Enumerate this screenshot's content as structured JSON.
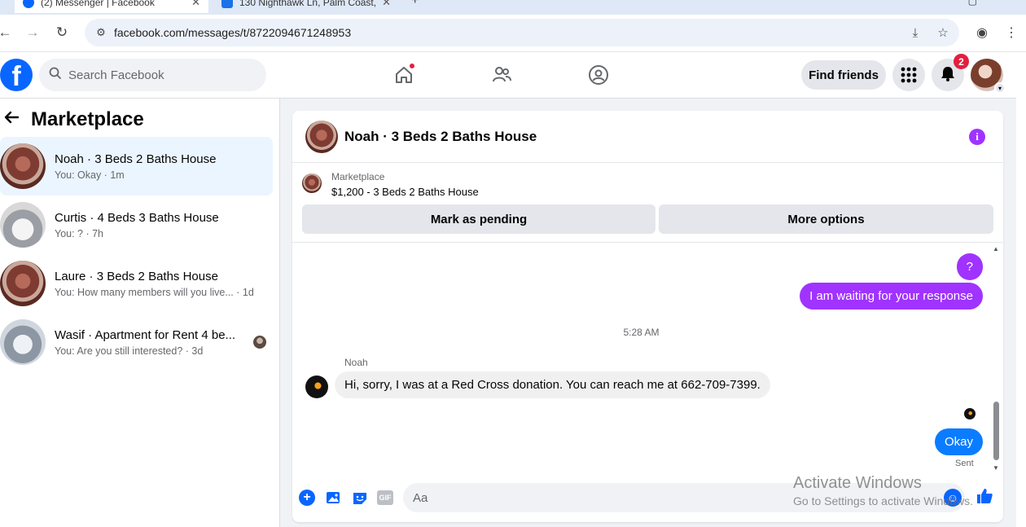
{
  "browser": {
    "tabs": [
      {
        "title": "(2) Messenger | Facebook",
        "active": true
      },
      {
        "title": "130 Nighthawk Ln, Palm Coast,",
        "active": false
      }
    ],
    "url": "facebook.com/messages/t/8722094671248953"
  },
  "fb_header": {
    "logo": "f",
    "search_placeholder": "Search Facebook",
    "find_friends": "Find friends",
    "notifications_count": "2",
    "icons": [
      "home-icon",
      "friends-icon",
      "groups-icon",
      "menu-grid-icon",
      "bell-icon"
    ]
  },
  "sidebar": {
    "title": "Marketplace",
    "conversations": [
      {
        "name": "Noah · 3 Beds 2 Baths House",
        "preview": "You: Okay · 1m",
        "selected": true
      },
      {
        "name": "Curtis · 4 Beds 3 Baths House",
        "preview": "You: ? · 7h",
        "selected": false
      },
      {
        "name": "Laure · 3 Beds 2 Baths House",
        "preview": "You: How many members will you live... · 1d",
        "selected": false
      },
      {
        "name": "Wasif · Apartment for Rent 4 be...",
        "preview": "You: Are you still interested? · 3d",
        "selected": false
      }
    ]
  },
  "chat": {
    "header_name": "Noah · 3 Beds 2 Baths House",
    "listing": {
      "label": "Marketplace",
      "price_title": "$1,200 - 3 Beds 2 Baths House",
      "mark_pending": "Mark as pending",
      "more_options": "More options"
    },
    "messages": {
      "out1": "?",
      "out2": "I am waiting for your response",
      "timestamp": "5:28 AM",
      "sender": "Noah",
      "in1": "Hi, sorry, I was at a Red Cross donation. You can reach me at 662-709-7399.",
      "out3": "Okay",
      "status": "Sent"
    },
    "composer_placeholder": "Aa",
    "gif_label": "GIF"
  },
  "watermark": {
    "line1": "Activate Windows",
    "line2": "Go to Settings to activate Windows."
  },
  "colors": {
    "fb_blue": "#0866ff",
    "purple_bubble": "#a033ff",
    "blue_bubble": "#0a7cff",
    "selected_row": "#ebf5ff"
  }
}
